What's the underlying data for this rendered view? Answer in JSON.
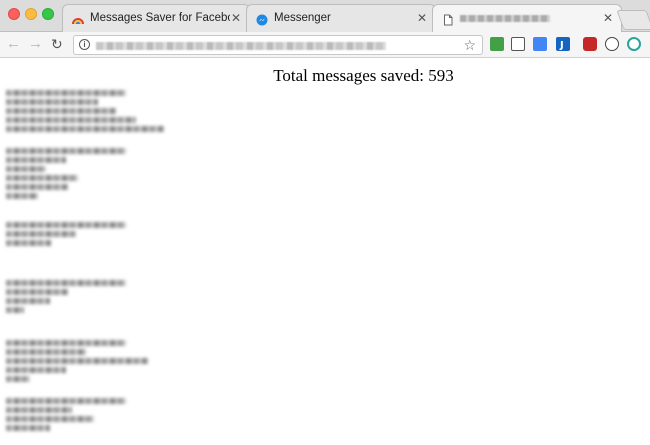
{
  "tabs": [
    {
      "title": "Messages Saver for Facebook",
      "favicon": "rainbow-icon",
      "active": false
    },
    {
      "title": "Messenger",
      "favicon": "messenger-icon",
      "active": false
    },
    {
      "title": "",
      "favicon": "document-icon",
      "active": true
    }
  ],
  "page": {
    "heading": "Total messages saved: 593"
  },
  "colors": {
    "messenger_blue": "#1e88e5",
    "close_red": "#fc605c",
    "minimize_yellow": "#fdbc40",
    "maximize_green": "#34c84a"
  }
}
